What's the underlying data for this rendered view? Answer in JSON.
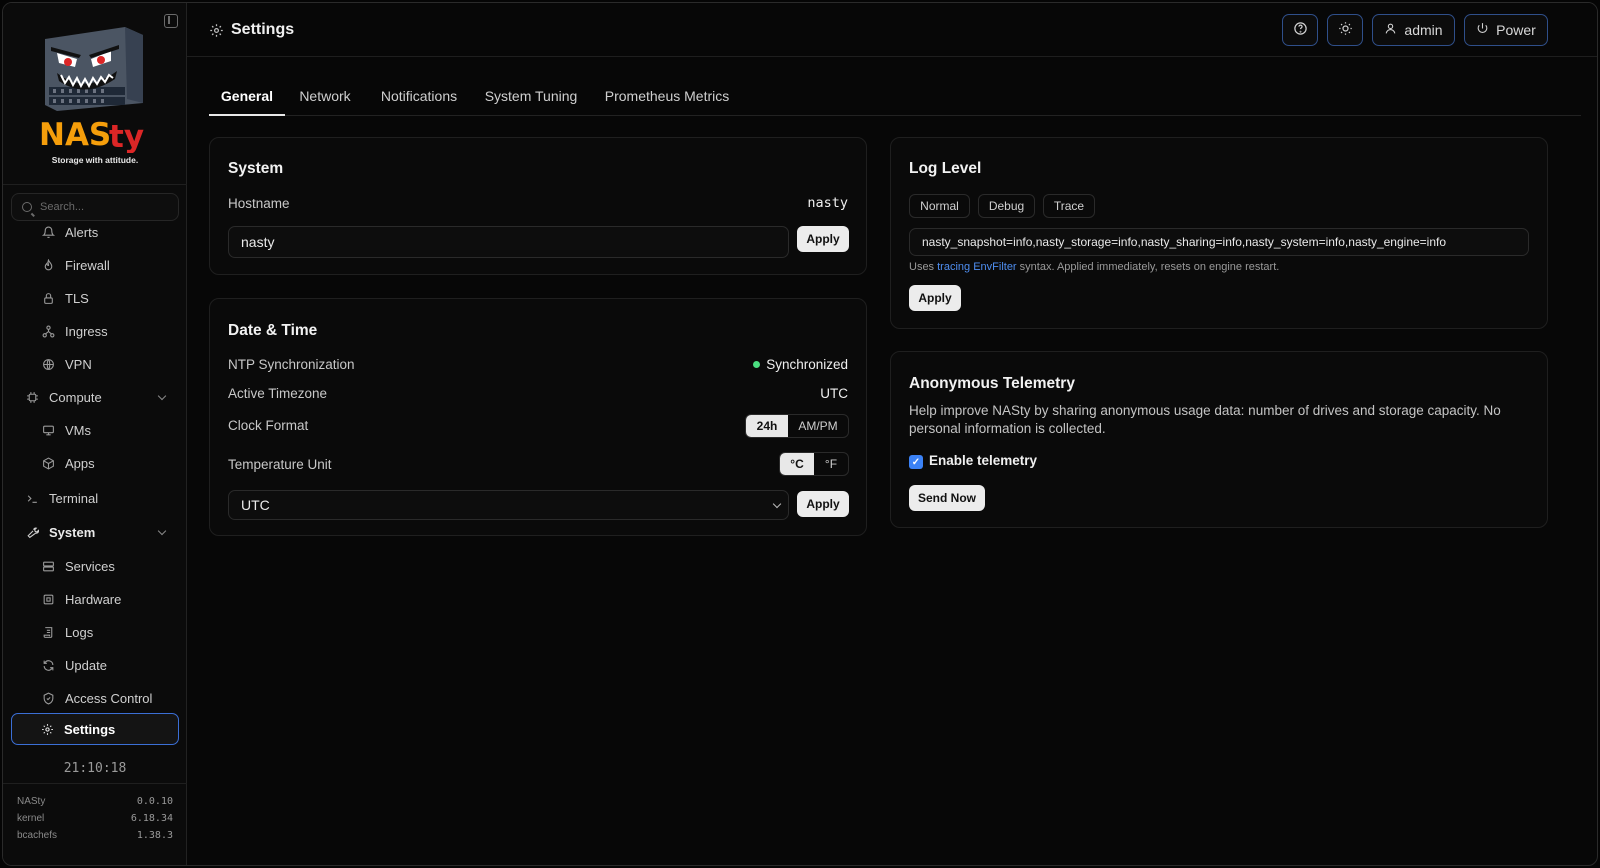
{
  "sidebar": {
    "brand": "NASty",
    "tagline": "Storage with attitude.",
    "search_placeholder": "Search...",
    "items": [
      {
        "label": "Alerts",
        "icon": "bell-icon"
      },
      {
        "label": "Firewall",
        "icon": "flame-icon"
      },
      {
        "label": "TLS",
        "icon": "lock-icon"
      },
      {
        "label": "Ingress",
        "icon": "network-icon"
      },
      {
        "label": "VPN",
        "icon": "globe-icon"
      },
      {
        "label": "Compute",
        "icon": "cpu-icon"
      },
      {
        "label": "VMs",
        "icon": "monitor-icon"
      },
      {
        "label": "Apps",
        "icon": "box-icon"
      },
      {
        "label": "Terminal",
        "icon": "terminal-icon"
      },
      {
        "label": "System",
        "icon": "wrench-icon"
      },
      {
        "label": "Services",
        "icon": "server-icon"
      },
      {
        "label": "Hardware",
        "icon": "chip-icon"
      },
      {
        "label": "Logs",
        "icon": "scroll-icon"
      },
      {
        "label": "Update",
        "icon": "refresh-icon"
      },
      {
        "label": "Access Control",
        "icon": "shield-icon"
      },
      {
        "label": "Settings",
        "icon": "gear-icon"
      }
    ],
    "clock": "21:10:18",
    "versions": [
      {
        "name": "NASty",
        "value": "0.0.10"
      },
      {
        "name": "kernel",
        "value": "6.18.34"
      },
      {
        "name": "bcachefs",
        "value": "1.38.3"
      }
    ]
  },
  "header": {
    "title": "Settings",
    "user": "admin",
    "power": "Power"
  },
  "tabs": [
    "General",
    "Network",
    "Notifications",
    "System Tuning",
    "Prometheus Metrics"
  ],
  "system_card": {
    "title": "System",
    "hostname_label": "Hostname",
    "hostname_value": "nasty",
    "hostname_input": "nasty",
    "apply": "Apply"
  },
  "datetime_card": {
    "title": "Date & Time",
    "ntp_label": "NTP Synchronization",
    "ntp_status": "Synchronized",
    "tz_label": "Active Timezone",
    "tz_value": "UTC",
    "clock_label": "Clock Format",
    "clock_options": [
      "24h",
      "AM/PM"
    ],
    "clock_selected": "24h",
    "temp_label": "Temperature Unit",
    "temp_options": [
      "°C",
      "°F"
    ],
    "temp_selected": "°C",
    "tz_select": "UTC",
    "apply": "Apply"
  },
  "log_card": {
    "title": "Log Level",
    "levels": [
      "Normal",
      "Debug",
      "Trace"
    ],
    "filter": "nasty_snapshot=info,nasty_storage=info,nasty_sharing=info,nasty_system=info,nasty_engine=info",
    "help_prefix": "Uses ",
    "help_link": "tracing EnvFilter",
    "help_suffix": " syntax. Applied immediately, resets on engine restart.",
    "apply": "Apply"
  },
  "telemetry_card": {
    "title": "Anonymous Telemetry",
    "description": "Help improve NASty by sharing anonymous usage data: number of drives and storage capacity. No personal information is collected.",
    "checkbox_label": "Enable telemetry",
    "checked": true,
    "send": "Send Now"
  },
  "colors": {
    "accent": "#3b6fd6",
    "link": "#4f8ef0",
    "ok": "#4ade80",
    "brand_orange": "#f59e0b",
    "brand_red": "#dc2626"
  }
}
